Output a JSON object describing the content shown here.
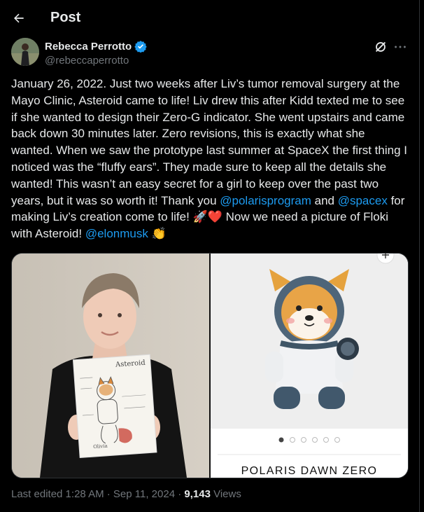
{
  "header": {
    "title": "Post"
  },
  "author": {
    "name": "Rebecca Perrotto",
    "handle": "@rebeccaperrotto",
    "verified": true
  },
  "post": {
    "text_1": "January 26, 2022. Just two weeks after Liv’s tumor removal surgery at the Mayo Clinic, Asteroid came to life! Liv drew this after Kidd texted me to see if she wanted to design their Zero-G indicator. She went upstairs and came back down 30 minutes later. Zero revisions, this is exactly what she wanted. When we saw the prototype last summer at SpaceX the first thing I noticed was the “fluffy ears”. They made sure to keep all the details she wanted!  This wasn’t an easy secret for a girl to keep over the past two years, but it was so worth it!  Thank you ",
    "mention_1": "@polarisprogram",
    "text_2": " and ",
    "mention_2": "@spacex",
    "text_3": " for making Liv’s creation come to life! 🚀❤️  Now we need a picture of Floki with Asteroid!  ",
    "mention_3": "@elonmusk",
    "text_4": " 👏"
  },
  "media": {
    "left": {
      "drawing_title": "Asteroid",
      "drawing_signature": "Olivia"
    },
    "right": {
      "caption": "POLARIS DAWN ZERO",
      "carousel_dots": 6,
      "carousel_active": 0
    }
  },
  "meta": {
    "edited_text": "Last edited 1:28 AM · Sep 11, 2024 · ",
    "views_count": "9,143",
    "views_label": " Views"
  },
  "colors": {
    "background": "#000000",
    "accent": "#1d9bf0",
    "muted": "#71767b",
    "text": "#e7e9ea",
    "border": "#2f3336"
  }
}
